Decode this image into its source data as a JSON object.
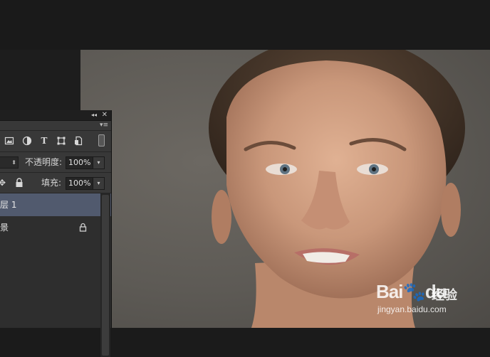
{
  "panel": {
    "collapse_glyph": "◂◂",
    "close_glyph": "✕",
    "menu_glyph": "▾≡",
    "filter_icons": [
      "image-filter-icon",
      "adjustment-filter-icon",
      "type-filter-icon",
      "shape-filter-icon",
      "smart-object-filter-icon"
    ],
    "opacity_label": "不透明度:",
    "opacity_value": "100%",
    "fill_label": "填充:",
    "fill_value": "100%",
    "layers": [
      {
        "name": "层 1",
        "selected": true,
        "locked": false
      },
      {
        "name": "景",
        "selected": false,
        "locked": true
      }
    ]
  },
  "watermark": {
    "logo": "Bai",
    "logo_tail": "du",
    "cn": "经验",
    "url": "jingyan.baidu.com"
  }
}
